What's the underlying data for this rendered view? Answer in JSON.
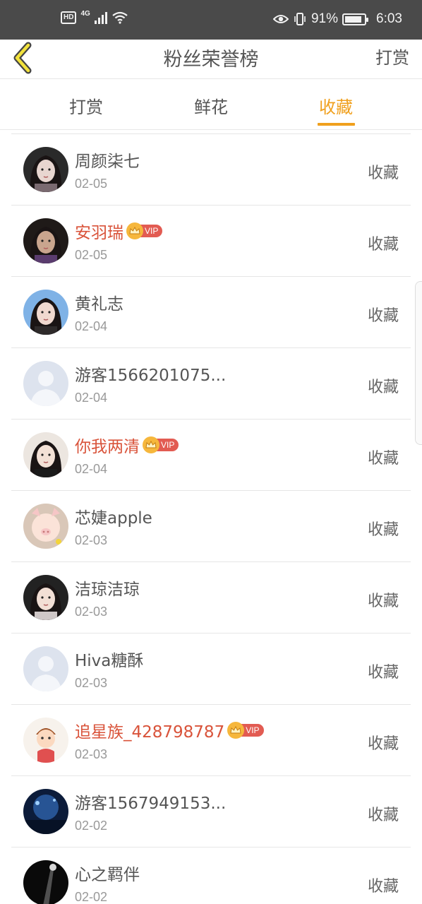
{
  "status_bar": {
    "hd": "HD",
    "network": "4G",
    "battery_percent": "91%",
    "battery_level": 0.91,
    "time": "6:03"
  },
  "header": {
    "title": "粉丝荣誉榜",
    "action": "打赏"
  },
  "tabs": [
    {
      "label": "打赏",
      "active": false
    },
    {
      "label": "鲜花",
      "active": false
    },
    {
      "label": "收藏",
      "active": true
    }
  ],
  "colors": {
    "accent": "#f0a01e",
    "vip_name": "#d9533a",
    "vip_tag": "#e25b52"
  },
  "vip_label": "VIP",
  "rows": [
    {
      "name": "周颜柒七",
      "date": "02-05",
      "action": "收藏",
      "vip": false,
      "avatar": "girl-photo"
    },
    {
      "name": "安羽瑞",
      "date": "02-05",
      "action": "收藏",
      "vip": true,
      "avatar": "girl-photo"
    },
    {
      "name": "黄礼志",
      "date": "02-04",
      "action": "收藏",
      "vip": false,
      "avatar": "girl-photo"
    },
    {
      "name": "游客1566201075...",
      "date": "02-04",
      "action": "收藏",
      "vip": false,
      "avatar": "default-avatar"
    },
    {
      "name": "你我两清",
      "date": "02-04",
      "action": "收藏",
      "vip": true,
      "avatar": "girl-photo"
    },
    {
      "name": "芯婕apple",
      "date": "02-03",
      "action": "收藏",
      "vip": false,
      "avatar": "pig-filter-photo"
    },
    {
      "name": "洁琼洁琼",
      "date": "02-03",
      "action": "收藏",
      "vip": false,
      "avatar": "girl-photo"
    },
    {
      "name": "Hiva糖酥",
      "date": "02-03",
      "action": "收藏",
      "vip": false,
      "avatar": "default-avatar"
    },
    {
      "name": "追星族_428798787",
      "date": "02-03",
      "action": "收藏",
      "vip": true,
      "avatar": "cartoon-avatar"
    },
    {
      "name": "游客1567949153...",
      "date": "02-02",
      "action": "收藏",
      "vip": false,
      "avatar": "concert-photo"
    },
    {
      "name": "心之羁伴",
      "date": "02-02",
      "action": "收藏",
      "vip": false,
      "avatar": "dark-photo"
    }
  ]
}
